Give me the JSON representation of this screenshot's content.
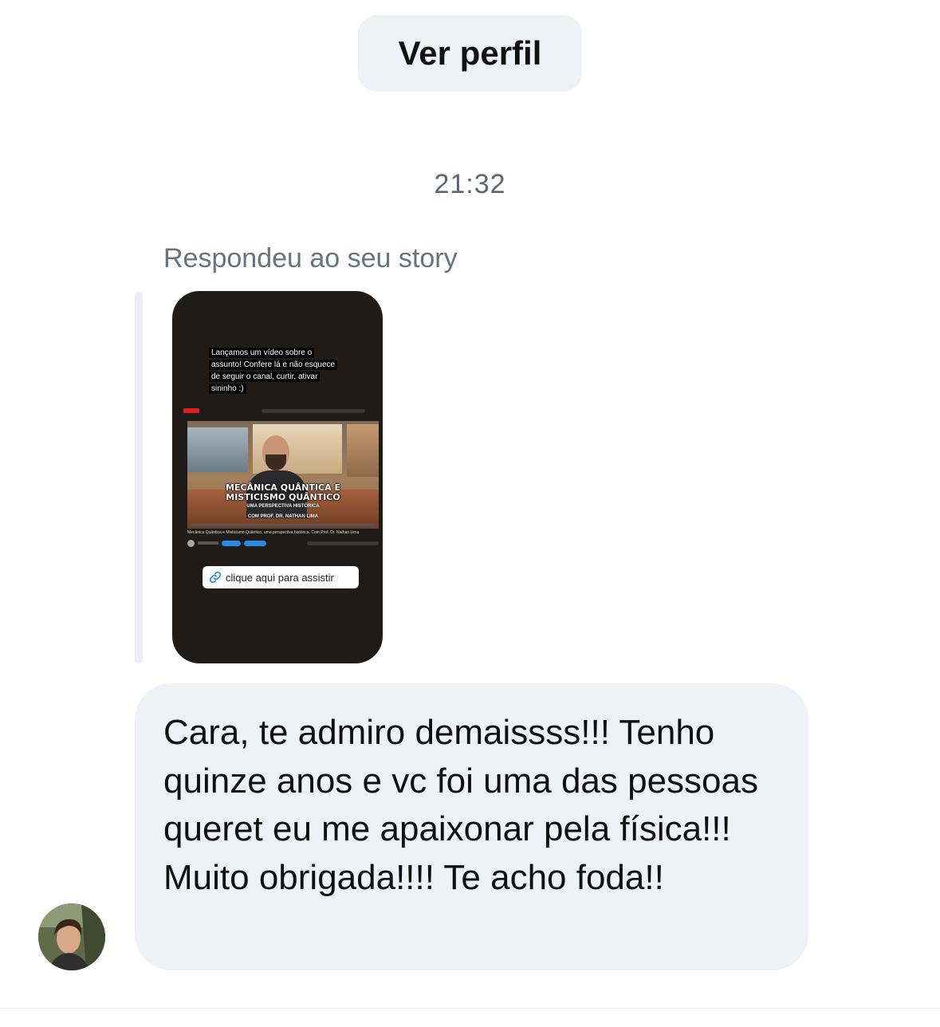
{
  "header": {
    "profile_button_label": "Ver perfil"
  },
  "thread": {
    "timestamp": "21:32",
    "reply_context": "Respondeu ao seu story"
  },
  "story": {
    "caption": "Lançamos um vídeo sobre o assunto! Confere lá e não esquece de seguir o canal, curtir, ativar sininho :)",
    "video_title_line1": "MECÂNICA QUÂNTICA E",
    "video_title_line2": "MISTICISMO QUÂNTICO",
    "video_subtitle": "UMA PERSPECTIVA HISTÓRICA",
    "video_credit": "COM PROF. DR. NATHAN LIMA",
    "video_meta": "Mecânica Quântica e Misticismo Quântico, uma perspectiva histórica. Com Prof. Dr. Nathan Lima",
    "link_sticker_label": "clique aqui para assistir"
  },
  "message": {
    "text": "Cara, te admiro demaissss!!! Tenho quinze anos e vc foi uma das pessoas queret eu me apaixonar pela física!!! Muito obrigada!!!! Te acho foda!!"
  },
  "colors": {
    "bubble_background": "#eff1f4",
    "timestamp_text": "#5f6670",
    "story_background": "#1f1b18",
    "link_icon": "#2a8be0"
  },
  "icons": {
    "link_sticker_icon": "link-icon"
  }
}
